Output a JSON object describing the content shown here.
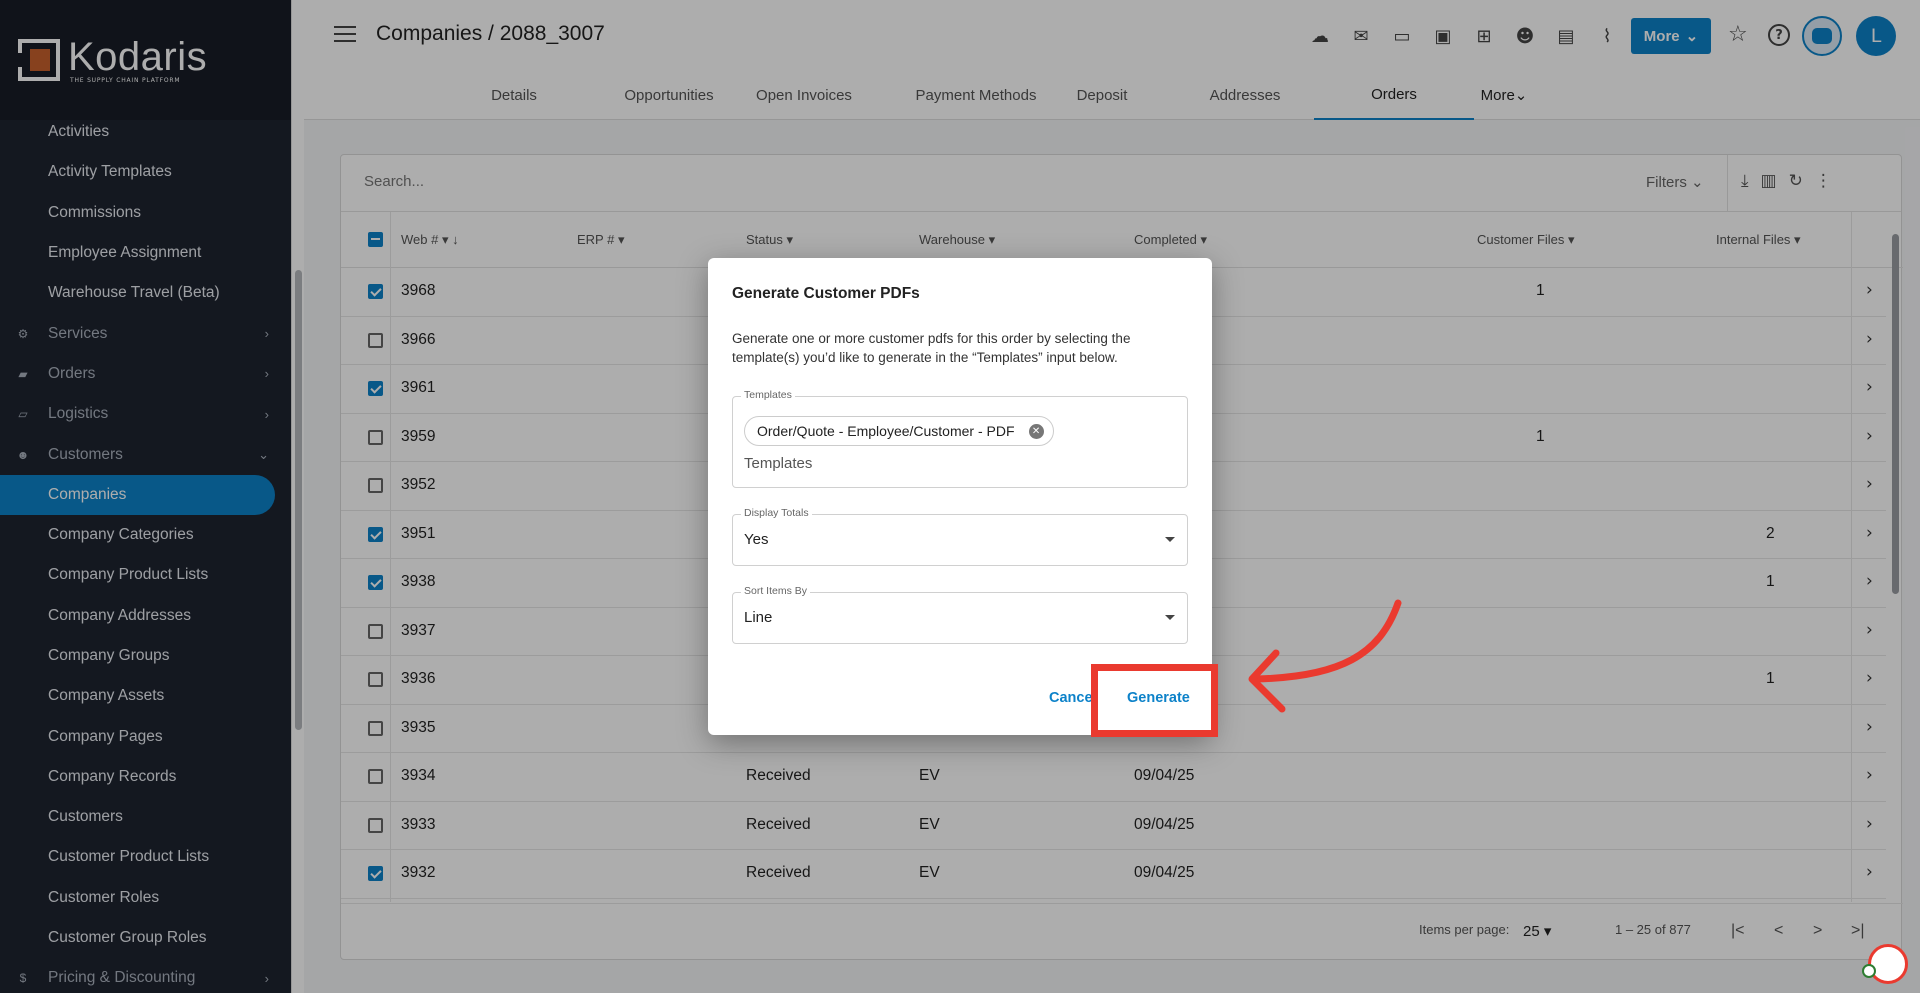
{
  "logo": {
    "name": "Kodaris",
    "tagline": "THE SUPPLY CHAIN PLATFORM"
  },
  "sidebar": {
    "items": [
      {
        "label": "Activities",
        "type": "sub"
      },
      {
        "label": "Activity Templates",
        "type": "sub"
      },
      {
        "label": "Commissions",
        "type": "sub"
      },
      {
        "label": "Employee Assignment",
        "type": "sub"
      },
      {
        "label": "Warehouse Travel (Beta)",
        "type": "sub"
      },
      {
        "label": "Services",
        "type": "section",
        "icon": "gears-icon"
      },
      {
        "label": "Orders",
        "type": "section",
        "icon": "truck-icon"
      },
      {
        "label": "Logistics",
        "type": "section",
        "icon": "forklift-icon"
      },
      {
        "label": "Customers",
        "type": "section",
        "icon": "people-icon"
      },
      {
        "label": "Companies",
        "type": "active"
      },
      {
        "label": "Company Categories",
        "type": "sub"
      },
      {
        "label": "Company Product Lists",
        "type": "sub"
      },
      {
        "label": "Company Addresses",
        "type": "sub"
      },
      {
        "label": "Company Groups",
        "type": "sub"
      },
      {
        "label": "Company Assets",
        "type": "sub"
      },
      {
        "label": "Company Pages",
        "type": "sub"
      },
      {
        "label": "Company Records",
        "type": "sub"
      },
      {
        "label": "Customers",
        "type": "sub"
      },
      {
        "label": "Customer Product Lists",
        "type": "sub"
      },
      {
        "label": "Customer Roles",
        "type": "sub"
      },
      {
        "label": "Customer Group Roles",
        "type": "sub"
      },
      {
        "label": "Pricing & Discounting",
        "type": "section",
        "icon": "dollar-icon"
      }
    ]
  },
  "header": {
    "title": "Companies / 2088_3007",
    "more_label": "More",
    "avatar_initial": "L"
  },
  "tabs": [
    {
      "label": "Details"
    },
    {
      "label": "Opportunities"
    },
    {
      "label": "Open Invoices"
    },
    {
      "label": "Payment Methods"
    },
    {
      "label": "Deposit"
    },
    {
      "label": "Addresses"
    },
    {
      "label": "Orders"
    },
    {
      "label": "More"
    }
  ],
  "table": {
    "search_placeholder": "Search...",
    "filters_label": "Filters",
    "columns": [
      "Web #",
      "ERP #",
      "Status",
      "Warehouse",
      "Completed",
      "Customer Files",
      "Internal Files"
    ],
    "rows": [
      {
        "web": "3968",
        "checked": true,
        "status": "",
        "warehouse": "",
        "completed": "",
        "customer_files": "1",
        "internal_files": ""
      },
      {
        "web": "3966",
        "checked": false,
        "status": "",
        "warehouse": "",
        "completed": "",
        "customer_files": "",
        "internal_files": ""
      },
      {
        "web": "3961",
        "checked": true,
        "status": "",
        "warehouse": "",
        "completed": "",
        "customer_files": "",
        "internal_files": ""
      },
      {
        "web": "3959",
        "checked": false,
        "status": "",
        "warehouse": "",
        "completed": "",
        "customer_files": "1",
        "internal_files": ""
      },
      {
        "web": "3952",
        "checked": false,
        "status": "",
        "warehouse": "",
        "completed": "",
        "customer_files": "",
        "internal_files": ""
      },
      {
        "web": "3951",
        "checked": true,
        "status": "",
        "warehouse": "",
        "completed": "",
        "customer_files": "",
        "internal_files": "2"
      },
      {
        "web": "3938",
        "checked": true,
        "status": "",
        "warehouse": "",
        "completed": "",
        "customer_files": "",
        "internal_files": "1"
      },
      {
        "web": "3937",
        "checked": false,
        "status": "",
        "warehouse": "",
        "completed": "",
        "customer_files": "",
        "internal_files": ""
      },
      {
        "web": "3936",
        "checked": false,
        "status": "",
        "warehouse": "",
        "completed": "",
        "customer_files": "",
        "internal_files": "1"
      },
      {
        "web": "3935",
        "checked": false,
        "status": "",
        "warehouse": "",
        "completed": "",
        "customer_files": "",
        "internal_files": ""
      },
      {
        "web": "3934",
        "checked": false,
        "status": "Received",
        "warehouse": "EV",
        "completed": "09/04/25",
        "customer_files": "",
        "internal_files": ""
      },
      {
        "web": "3933",
        "checked": false,
        "status": "Received",
        "warehouse": "EV",
        "completed": "09/04/25",
        "customer_files": "",
        "internal_files": ""
      },
      {
        "web": "3932",
        "checked": true,
        "status": "Received",
        "warehouse": "EV",
        "completed": "09/04/25",
        "customer_files": "",
        "internal_files": ""
      }
    ],
    "items_per_page_label": "Items per page:",
    "items_per_page": "25",
    "range": "1 – 25 of 877"
  },
  "modal": {
    "title": "Generate Customer PDFs",
    "description": "Generate one or more customer pdfs for this order by selecting the template(s) you’d like to generate in the “Templates” input below.",
    "templates_label": "Templates",
    "template_chip": "Order/Quote - Employee/Customer - PDF",
    "templates_placeholder": "Templates",
    "display_totals_label": "Display Totals",
    "display_totals_value": "Yes",
    "sort_items_label": "Sort Items By",
    "sort_items_value": "Line",
    "cancel_label": "Cancel",
    "generate_label": "Generate"
  },
  "colors": {
    "accent": "#0d82c9",
    "highlight": "#ea3a2f",
    "sidebar": "#1e2430"
  }
}
